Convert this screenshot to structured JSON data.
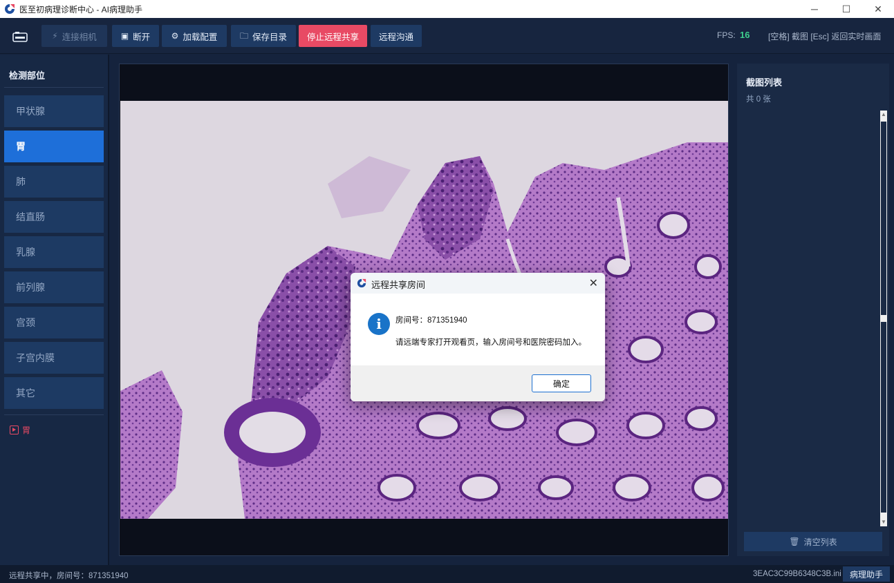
{
  "window": {
    "title": "医至初病理诊断中心 - AI病理助手",
    "controls": [
      "─",
      "☐",
      "✕"
    ]
  },
  "toolbar": {
    "connect_camera": "连接相机",
    "disconnect": "断开",
    "load_config": "加载配置",
    "save_dir": "保存目录",
    "stop_share": "停止远程共享",
    "remote_chat": "远程沟通",
    "fps_label": "FPS:",
    "fps_value": "16",
    "hint": "[空格] 截图  [Esc] 返回实时画面"
  },
  "sidebar": {
    "title": "检测部位",
    "items": [
      {
        "label": "甲状腺",
        "active": false
      },
      {
        "label": "胃",
        "active": true
      },
      {
        "label": "肺",
        "active": false
      },
      {
        "label": "结直肠",
        "active": false
      },
      {
        "label": "乳腺",
        "active": false
      },
      {
        "label": "前列腺",
        "active": false
      },
      {
        "label": "宫颈",
        "active": false
      },
      {
        "label": "子宫内膜",
        "active": false
      },
      {
        "label": "其它",
        "active": false
      }
    ],
    "current": "胃"
  },
  "screenshots": {
    "title": "截图列表",
    "count": "共 0 张",
    "clear_button": "清空列表"
  },
  "statusbar": {
    "status": "远程共享中，房间号：871351940",
    "ini_file": "3EAC3C99B6348C3B.ini",
    "assistant": "病理助手"
  },
  "dialog": {
    "title": "远程共享房间",
    "room_line": "房间号：871351940",
    "instruction": "请远端专家打开观看页，输入房间号和医院密码加入。",
    "ok_button": "确定"
  },
  "colors": {
    "accent": "#1e6fd9",
    "danger": "#e84a64",
    "fps": "#3ecf8e",
    "background": "#15233d"
  }
}
